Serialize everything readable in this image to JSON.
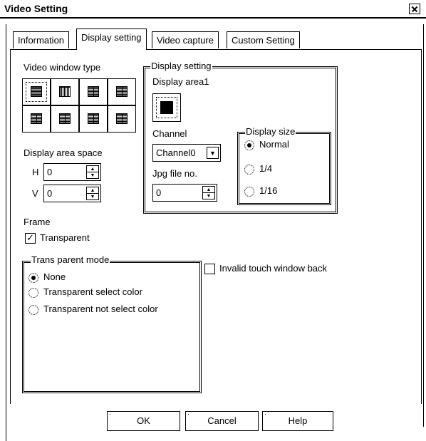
{
  "window": {
    "title": "Video Setting"
  },
  "tabs": [
    "Information",
    "Display setting",
    "Video capture",
    "Custom Setting"
  ],
  "video_window_type": {
    "label": "Video window type",
    "selected_index": 0
  },
  "display_area_space": {
    "label": "Display area space",
    "h_label": "H",
    "h_value": "0",
    "v_label": "V",
    "v_value": "0"
  },
  "display_setting": {
    "group_label": "Display setting",
    "area_label": "Display area1",
    "channel_label": "Channel",
    "channel_value": "Channel0",
    "jpg_label": "Jpg file no.",
    "jpg_value": "0",
    "display_size": {
      "label": "Display size",
      "options": [
        "Normal",
        "1/4",
        "1/16"
      ],
      "selected": "Normal"
    }
  },
  "frame": {
    "label": "Frame",
    "transparent_label": "Transparent",
    "transparent_checked": true
  },
  "trans_parent_mode": {
    "label": "Trans parent mode",
    "options": [
      "None",
      "Transparent select color",
      "Transparent not select color"
    ],
    "selected": "None"
  },
  "invalid_touch": {
    "label": "Invalid touch window back",
    "checked": false
  },
  "buttons": {
    "ok": "OK",
    "cancel": "Cancel",
    "help": "Help"
  }
}
